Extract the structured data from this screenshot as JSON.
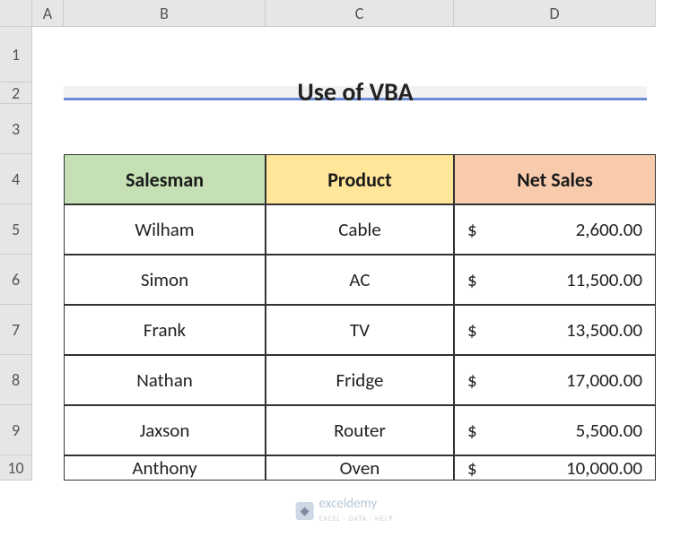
{
  "columns": [
    "A",
    "B",
    "C",
    "D"
  ],
  "rows": [
    "1",
    "2",
    "3",
    "4",
    "5",
    "6",
    "7",
    "8",
    "9",
    "10"
  ],
  "title": "Use of VBA",
  "headers": {
    "salesman": "Salesman",
    "product": "Product",
    "net_sales": "Net Sales"
  },
  "currency": "$",
  "table": [
    {
      "salesman": "Wilham",
      "product": "Cable",
      "net_sales": "2,600.00"
    },
    {
      "salesman": "Simon",
      "product": "AC",
      "net_sales": "11,500.00"
    },
    {
      "salesman": "Frank",
      "product": "TV",
      "net_sales": "13,500.00"
    },
    {
      "salesman": "Nathan",
      "product": "Fridge",
      "net_sales": "17,000.00"
    },
    {
      "salesman": "Jaxson",
      "product": "Router",
      "net_sales": "5,500.00"
    },
    {
      "salesman": "Anthony",
      "product": "Oven",
      "net_sales": "10,000.00"
    }
  ],
  "watermark": {
    "brand": "exceldemy",
    "tagline": "EXCEL · DATA · HELP"
  },
  "chart_data": {
    "type": "table",
    "title": "Use of VBA",
    "columns": [
      "Salesman",
      "Product",
      "Net Sales"
    ],
    "rows": [
      [
        "Wilham",
        "Cable",
        2600.0
      ],
      [
        "Simon",
        "AC",
        11500.0
      ],
      [
        "Frank",
        "TV",
        13500.0
      ],
      [
        "Nathan",
        "Fridge",
        17000.0
      ],
      [
        "Jaxson",
        "Router",
        5500.0
      ],
      [
        "Anthony",
        "Oven",
        10000.0
      ]
    ],
    "currency": "USD"
  }
}
